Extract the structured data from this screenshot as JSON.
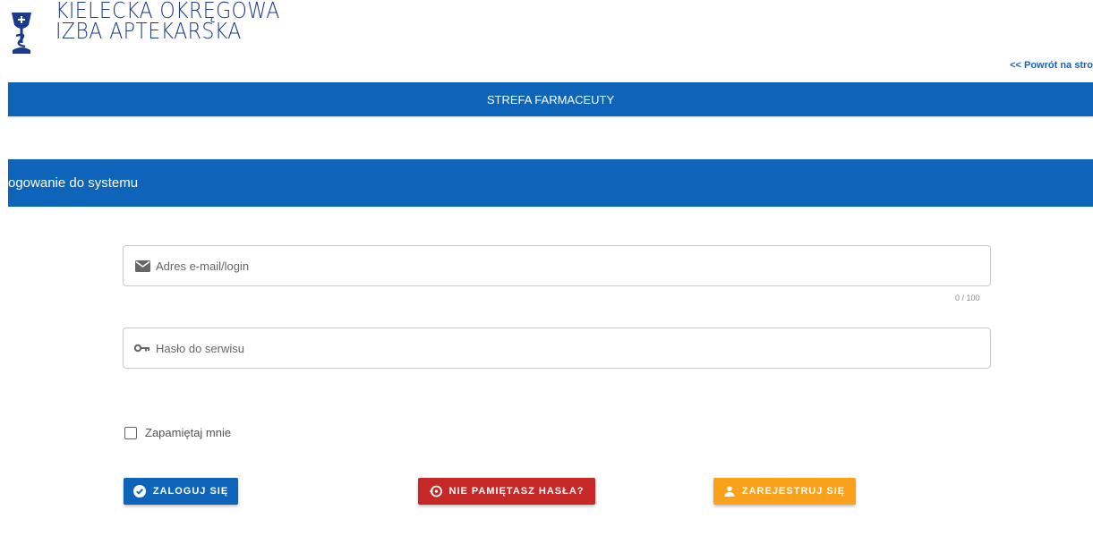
{
  "header": {
    "logo_line1": "KIELECKA OKRĘGOWA",
    "logo_line2": "IZBA APTEKARSKA",
    "back_link": "<< Powrót na stro"
  },
  "top_bar": {
    "title": "STREFA FARMACEUTY"
  },
  "section": {
    "title": "ogowanie do systemu"
  },
  "form": {
    "email_placeholder": "Adres e-mail/login",
    "email_value": "",
    "email_counter": "0 / 100",
    "password_placeholder": "Hasło do serwisu",
    "password_value": "",
    "remember_label": "Zapamiętaj mnie",
    "remember_checked": false
  },
  "buttons": {
    "login": "ZALOGUJ SIĘ",
    "forgot": "NIE PAMIĘTASZ HASŁA?",
    "register": "ZAREJESTRUJ SIĘ"
  },
  "colors": {
    "primary": "#0d64b8",
    "danger": "#c62828",
    "warning": "#f9a11b",
    "logo": "#1a3a8a"
  },
  "icons": {
    "logo": "chalice-snake-icon",
    "email": "envelope-icon",
    "password": "key-icon",
    "login": "check-circle-icon",
    "forgot": "reset-icon",
    "register": "person-icon"
  }
}
